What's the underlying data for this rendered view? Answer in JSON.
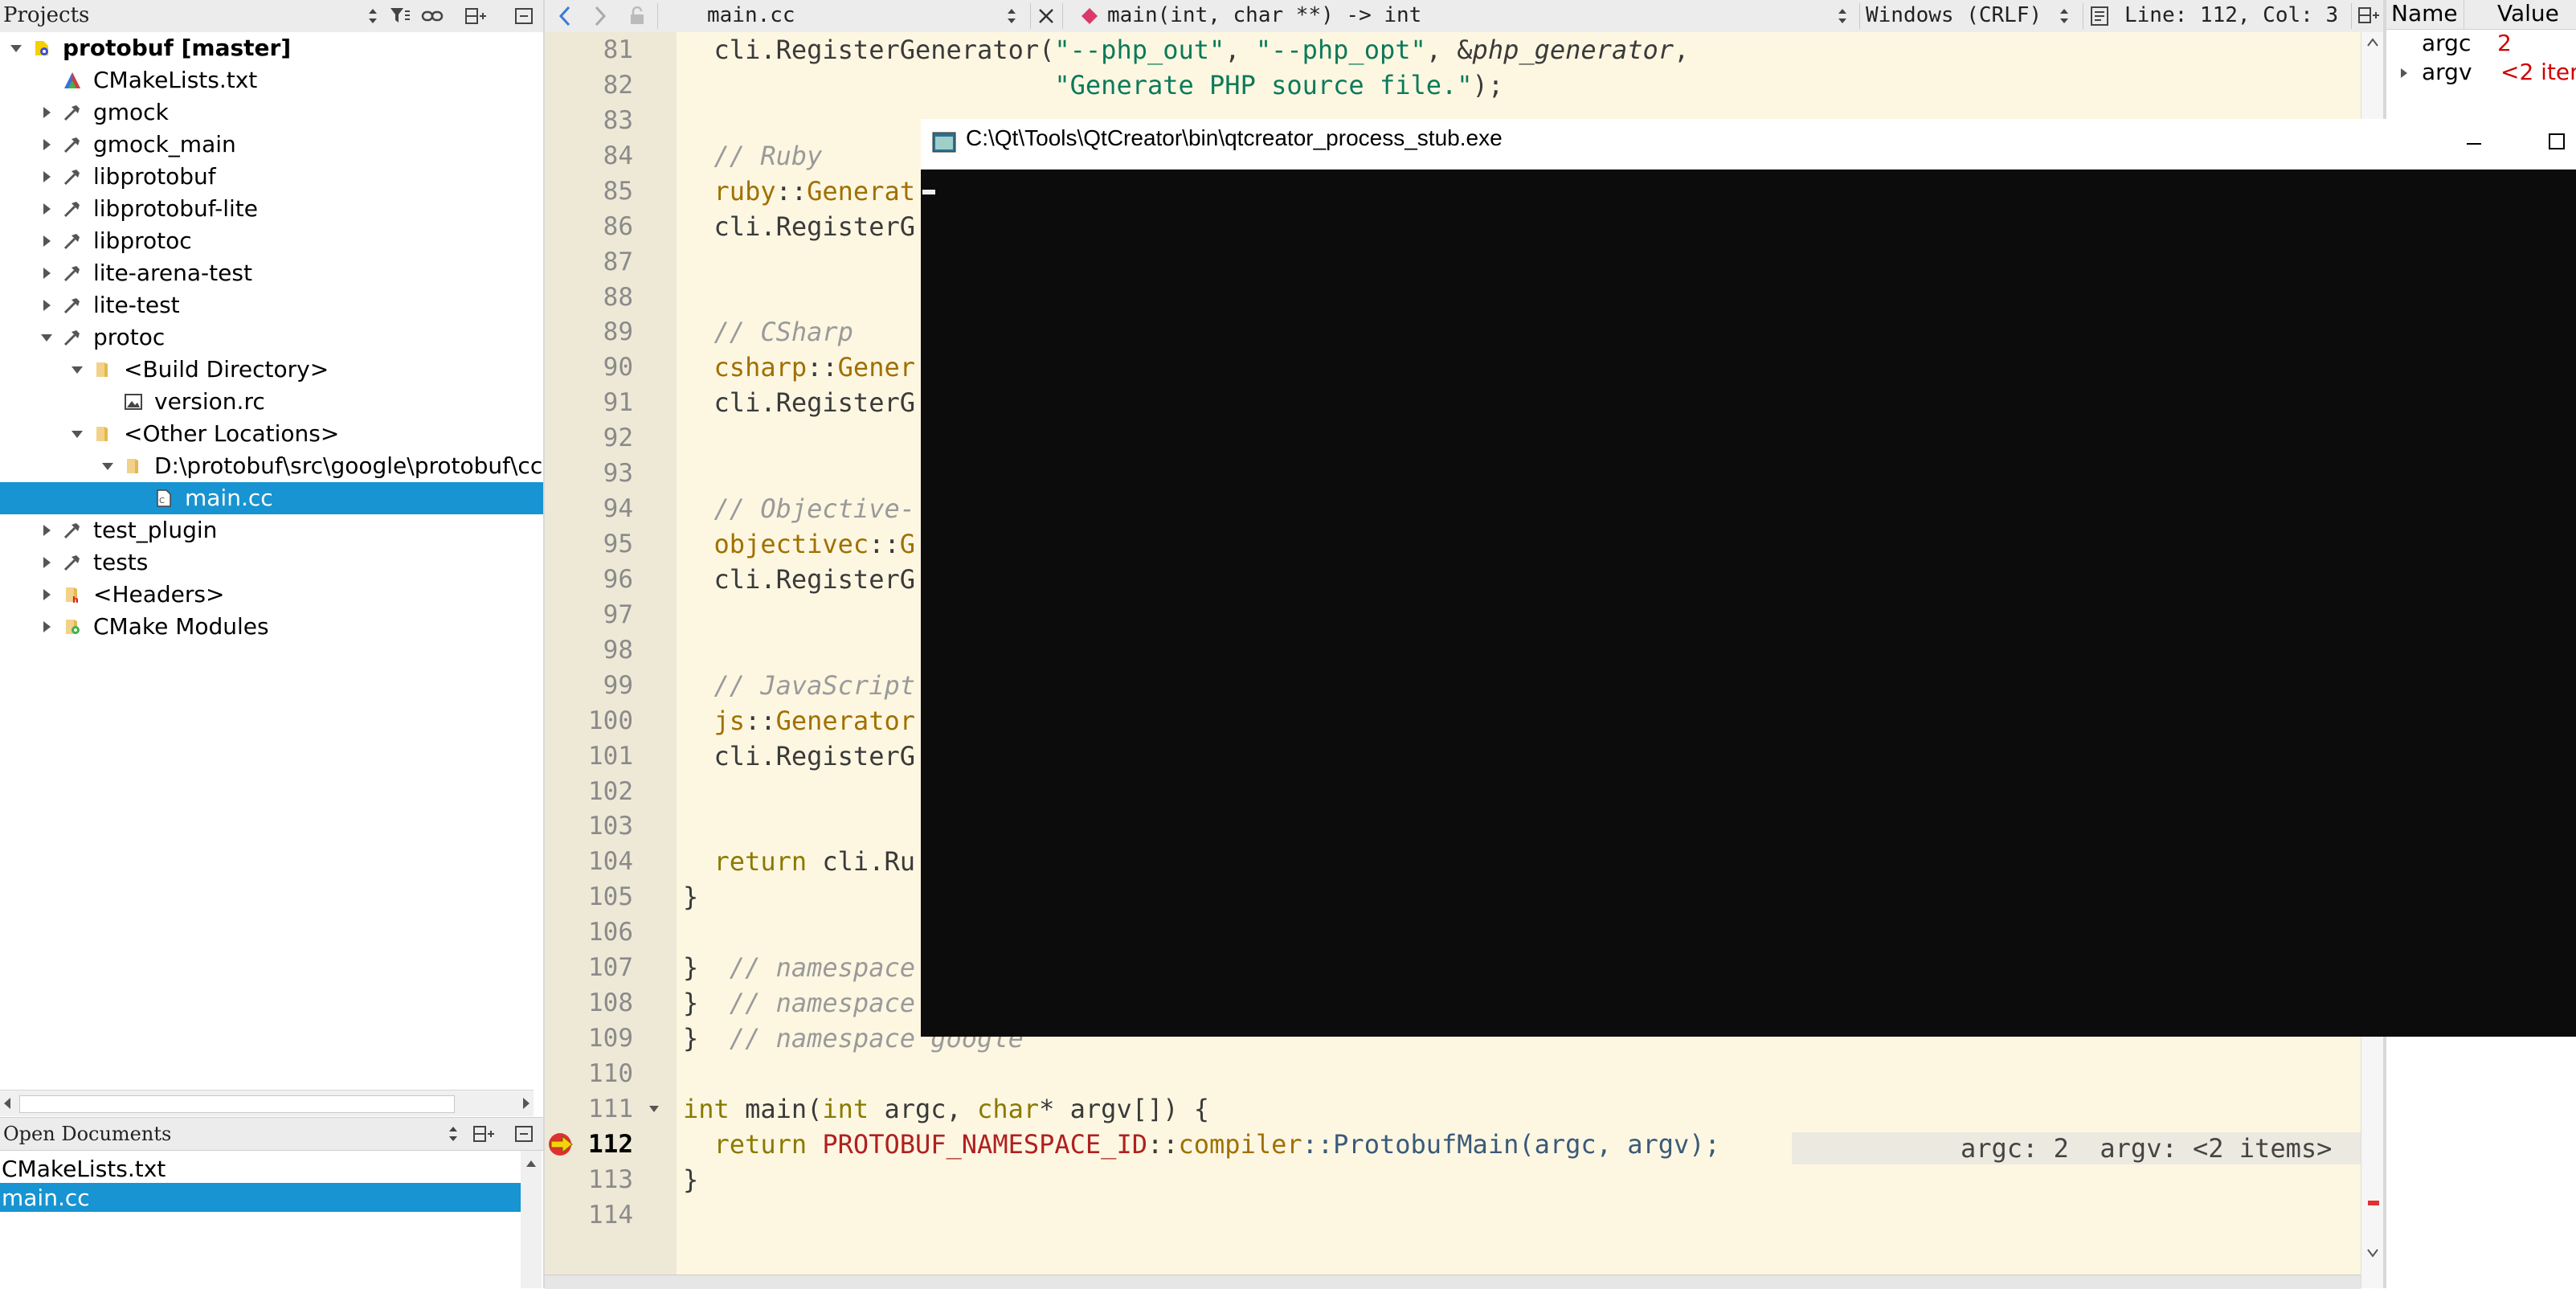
{
  "projects_panel": {
    "title": "Projects",
    "tree": [
      {
        "label": "protobuf [master]",
        "icon": "cmake-project-icon",
        "expanded": true,
        "bold": true
      },
      {
        "label": "CMakeLists.txt",
        "icon": "cmake-file-icon"
      },
      {
        "label": "gmock",
        "icon": "hammer-icon",
        "expanded": false
      },
      {
        "label": "gmock_main",
        "icon": "hammer-icon",
        "expanded": false
      },
      {
        "label": "libprotobuf",
        "icon": "hammer-icon",
        "expanded": false
      },
      {
        "label": "libprotobuf-lite",
        "icon": "hammer-icon",
        "expanded": false
      },
      {
        "label": "libprotoc",
        "icon": "hammer-icon",
        "expanded": false
      },
      {
        "label": "lite-arena-test",
        "icon": "hammer-icon",
        "expanded": false
      },
      {
        "label": "lite-test",
        "icon": "hammer-icon",
        "expanded": false
      },
      {
        "label": "protoc",
        "icon": "hammer-icon",
        "expanded": true
      },
      {
        "label": "<Build Directory>",
        "icon": "folder-icon",
        "expanded": true
      },
      {
        "label": "version.rc",
        "icon": "image-file-icon"
      },
      {
        "label": "<Other Locations>",
        "icon": "folder-icon",
        "expanded": true
      },
      {
        "label": "D:\\protobuf\\src\\google\\protobuf\\cc",
        "icon": "folder-icon",
        "expanded": true
      },
      {
        "label": "main.cc",
        "icon": "source-file-icon",
        "selected": true
      },
      {
        "label": "test_plugin",
        "icon": "hammer-icon",
        "expanded": false
      },
      {
        "label": "tests",
        "icon": "hammer-icon",
        "expanded": false
      },
      {
        "label": "<Headers>",
        "icon": "headers-folder-icon",
        "expanded": false
      },
      {
        "label": "CMake Modules",
        "icon": "cmake-modules-icon",
        "expanded": false
      }
    ]
  },
  "open_documents": {
    "title": "Open Documents",
    "items": [
      "CMakeLists.txt",
      "main.cc"
    ],
    "selected_index": 1
  },
  "editor_toolbar": {
    "file": "main.cc",
    "symbol": "main(int, char **) -> int",
    "line_ending": "Windows (CRLF)",
    "position": "Line: 112, Col: 3"
  },
  "editor": {
    "current_line": 112,
    "breakpoint_line": 112,
    "lines": [
      {
        "n": 81,
        "tokens": [
          [
            "  cli.RegisterGenerator(",
            ""
          ],
          [
            "\"--php_out\"",
            "str"
          ],
          [
            ", ",
            ""
          ],
          [
            "\"--php_opt\"",
            "str"
          ],
          [
            ", &",
            ""
          ],
          [
            "php_generator",
            "it"
          ],
          [
            ",",
            ""
          ]
        ]
      },
      {
        "n": 82,
        "tokens": [
          [
            "                        ",
            ""
          ],
          [
            "\"Generate PHP source file.\"",
            "str"
          ],
          [
            ");",
            ""
          ]
        ]
      },
      {
        "n": 83,
        "tokens": []
      },
      {
        "n": 84,
        "tokens": [
          [
            "  ",
            ""
          ],
          [
            "// Ruby",
            "com"
          ]
        ]
      },
      {
        "n": 85,
        "tokens": [
          [
            "  ",
            ""
          ],
          [
            "ruby",
            "ns"
          ],
          [
            "::",
            ""
          ],
          [
            "Generat",
            "ns"
          ]
        ]
      },
      {
        "n": 86,
        "tokens": [
          [
            "  cli.RegisterG",
            ""
          ]
        ]
      },
      {
        "n": 87,
        "tokens": []
      },
      {
        "n": 88,
        "tokens": []
      },
      {
        "n": 89,
        "tokens": [
          [
            "  ",
            ""
          ],
          [
            "// CSharp",
            "com"
          ]
        ]
      },
      {
        "n": 90,
        "tokens": [
          [
            "  ",
            ""
          ],
          [
            "csharp",
            "ns"
          ],
          [
            "::",
            ""
          ],
          [
            "Gener",
            "ns"
          ]
        ]
      },
      {
        "n": 91,
        "tokens": [
          [
            "  cli.RegisterG",
            ""
          ]
        ]
      },
      {
        "n": 92,
        "tokens": []
      },
      {
        "n": 93,
        "tokens": []
      },
      {
        "n": 94,
        "tokens": [
          [
            "  ",
            ""
          ],
          [
            "// Objective-",
            "com"
          ]
        ]
      },
      {
        "n": 95,
        "tokens": [
          [
            "  ",
            ""
          ],
          [
            "objectivec",
            "ns"
          ],
          [
            "::",
            ""
          ],
          [
            "G",
            "ns"
          ]
        ]
      },
      {
        "n": 96,
        "tokens": [
          [
            "  cli.RegisterG",
            ""
          ]
        ]
      },
      {
        "n": 97,
        "tokens": []
      },
      {
        "n": 98,
        "tokens": []
      },
      {
        "n": 99,
        "tokens": [
          [
            "  ",
            ""
          ],
          [
            "// JavaScript",
            "com"
          ]
        ]
      },
      {
        "n": 100,
        "tokens": [
          [
            "  ",
            ""
          ],
          [
            "js",
            "ns"
          ],
          [
            "::",
            ""
          ],
          [
            "Generator",
            "ns"
          ]
        ]
      },
      {
        "n": 101,
        "tokens": [
          [
            "  cli.RegisterG",
            ""
          ]
        ]
      },
      {
        "n": 102,
        "tokens": []
      },
      {
        "n": 103,
        "tokens": []
      },
      {
        "n": 104,
        "tokens": [
          [
            "  ",
            ""
          ],
          [
            "return",
            "kw"
          ],
          [
            " cli.Ru",
            ""
          ]
        ]
      },
      {
        "n": 105,
        "tokens": [
          [
            "}",
            ""
          ]
        ]
      },
      {
        "n": 106,
        "tokens": []
      },
      {
        "n": 107,
        "tokens": [
          [
            "}  ",
            ""
          ],
          [
            "// namespace",
            "com"
          ]
        ]
      },
      {
        "n": 108,
        "tokens": [
          [
            "}  ",
            ""
          ],
          [
            "// namespace",
            "com"
          ]
        ]
      },
      {
        "n": 109,
        "tokens": [
          [
            "}  ",
            ""
          ],
          [
            "// namespace google",
            "com"
          ]
        ]
      },
      {
        "n": 110,
        "tokens": []
      },
      {
        "n": 111,
        "tokens": [
          [
            "int",
            "kw"
          ],
          [
            " main(",
            ""
          ],
          [
            "int",
            "kw"
          ],
          [
            " argc, ",
            ""
          ],
          [
            "char",
            "kw"
          ],
          [
            "* argv[]) {",
            ""
          ]
        ]
      },
      {
        "n": 112,
        "tokens": [
          [
            "  ",
            ""
          ],
          [
            "return",
            "kw"
          ],
          [
            " ",
            ""
          ],
          [
            "PROTOBUF_NAMESPACE_ID",
            "mac"
          ],
          [
            "::",
            ""
          ],
          [
            "compiler",
            "ns"
          ],
          [
            "::ProtobufMain(argc, argv);",
            "fn"
          ]
        ]
      },
      {
        "n": 113,
        "tokens": [
          [
            "}",
            ""
          ]
        ]
      },
      {
        "n": 114,
        "tokens": []
      }
    ],
    "debug_hint": "argc: 2  argv: <2 items>"
  },
  "locals": {
    "headers": [
      "Name",
      "Value"
    ],
    "rows": [
      {
        "name": "argc",
        "value": "2",
        "expandable": false
      },
      {
        "name": "argv",
        "value": "<2 item",
        "expandable": true
      }
    ]
  },
  "console_window": {
    "title": "C:\\Qt\\Tools\\QtCreator\\bin\\qtcreator_process_stub.exe",
    "background": "#0c0c0c"
  },
  "colors": {
    "selection": "#1794d1",
    "editor_bg": "#fdf7e2",
    "gutter_bg": "#eee9d7",
    "breakpoint": "#e03030",
    "locals_value": "#d00000"
  }
}
